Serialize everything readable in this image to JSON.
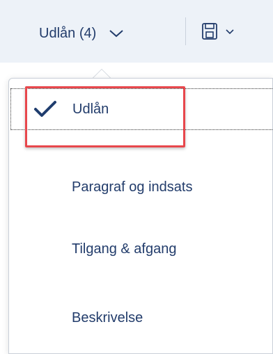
{
  "toolbar": {
    "view_select_label": "Udlån (4)",
    "chevron_icon": "chevron-down-icon",
    "save_icon": "save-icon"
  },
  "menu": {
    "items": [
      {
        "label": "Udlån",
        "selected": true
      },
      {
        "label": "Paragraf og indsats",
        "selected": false
      },
      {
        "label": "Tilgang & afgang",
        "selected": false
      },
      {
        "label": "Beskrivelse",
        "selected": false
      }
    ]
  },
  "colors": {
    "text": "#223c6b",
    "check": "#1f3d6e",
    "highlight": "#e8474c",
    "toolbar_bg": "#edf2f8"
  }
}
